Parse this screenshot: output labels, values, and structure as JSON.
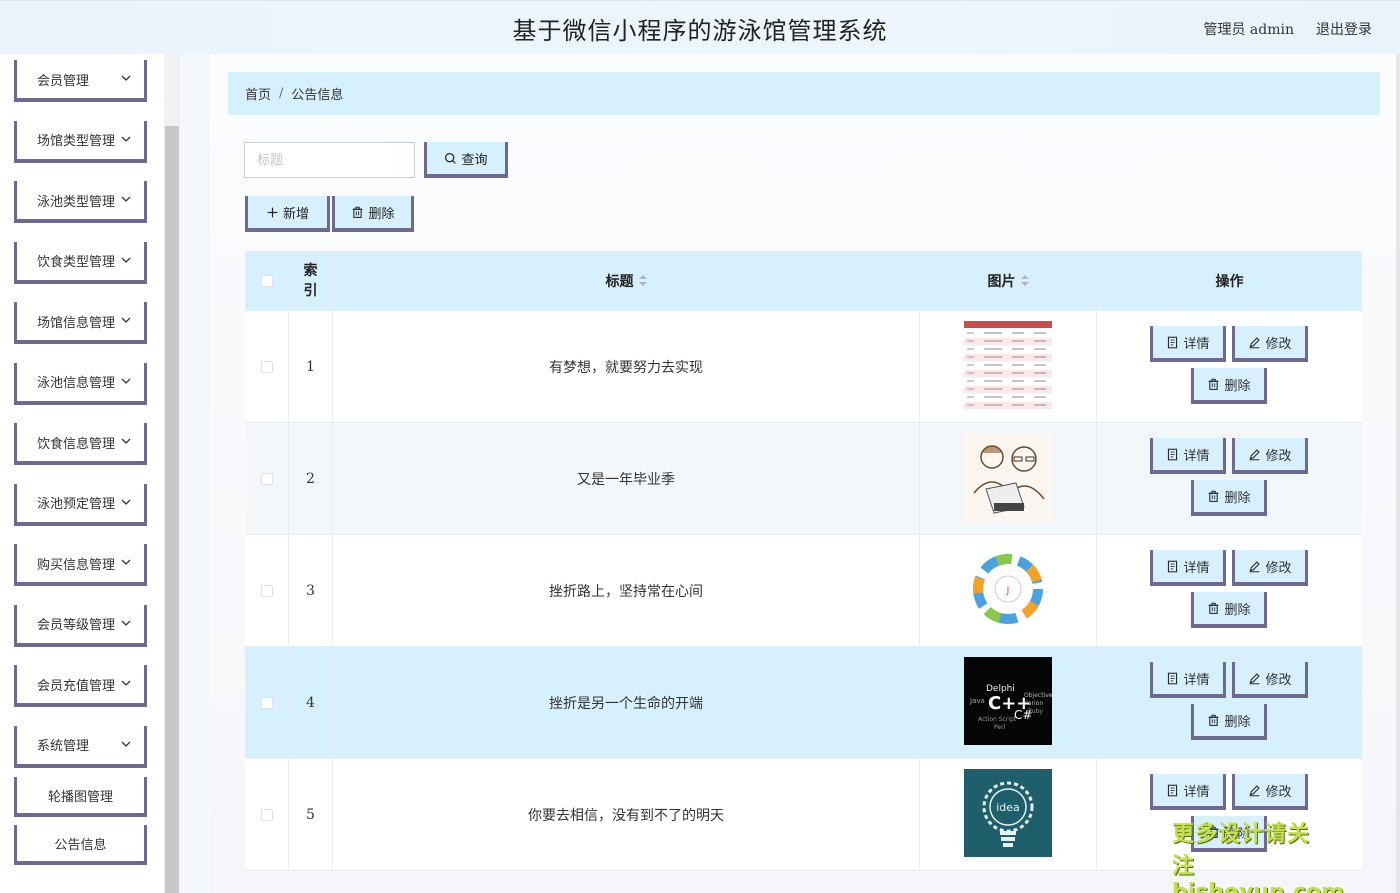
{
  "header": {
    "title": "基于微信小程序的游泳馆管理系统",
    "user": "管理员 admin",
    "logout": "退出登录"
  },
  "sidebar": {
    "items": [
      {
        "label": "会员管理"
      },
      {
        "label": "场馆类型管理"
      },
      {
        "label": "泳池类型管理"
      },
      {
        "label": "饮食类型管理"
      },
      {
        "label": "场馆信息管理"
      },
      {
        "label": "泳池信息管理"
      },
      {
        "label": "饮食信息管理"
      },
      {
        "label": "泳池预定管理"
      },
      {
        "label": "购买信息管理"
      },
      {
        "label": "会员等级管理"
      },
      {
        "label": "会员充值管理"
      },
      {
        "label": "系统管理"
      }
    ],
    "sub_items": [
      {
        "label": "轮播图管理"
      },
      {
        "label": "公告信息"
      }
    ]
  },
  "breadcrumb": {
    "home": "首页",
    "separator": "/",
    "current": "公告信息"
  },
  "search": {
    "placeholder": "标题",
    "value": "",
    "button": "查询"
  },
  "toolbar": {
    "add": "新增",
    "delete": "删除"
  },
  "table": {
    "headers": {
      "index": "索引",
      "title": "标题",
      "image": "图片",
      "ops": "操作"
    },
    "rows": [
      {
        "index": "1",
        "title": "有梦想，就要努力去实现",
        "image": "spreadsheet-thumbnail"
      },
      {
        "index": "2",
        "title": "又是一年毕业季",
        "image": "sketch-people-laptop-thumbnail"
      },
      {
        "index": "3",
        "title": "挫折路上，坚持常在心间",
        "image": "java-wheel-thumbnail"
      },
      {
        "index": "4",
        "title": "挫折是另一个生命的开端",
        "image": "programming-words-thumbnail"
      },
      {
        "index": "5",
        "title": "你要去相信，没有到不了的明天",
        "image": "idea-bulb-thumbnail"
      }
    ],
    "row_ops": {
      "detail": "详情",
      "edit": "修改",
      "delete": "删除"
    }
  },
  "watermark": {
    "line1": "更多设计请关注",
    "line2": "bisheyun.com"
  },
  "colors": {
    "accent": "#d7f0fd",
    "border": "#6d6a91"
  }
}
